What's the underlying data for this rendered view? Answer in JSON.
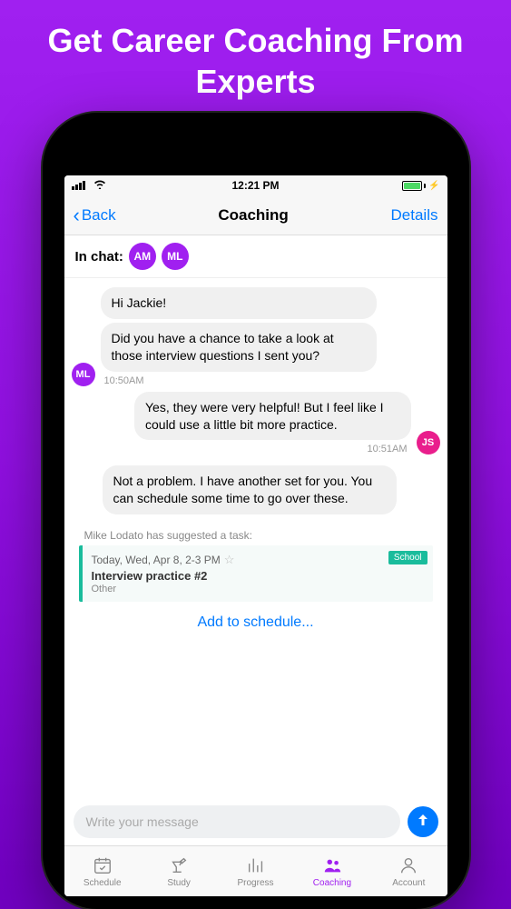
{
  "headline": "Get Career Coaching From Experts",
  "status": {
    "time": "12:21 PM"
  },
  "nav": {
    "back": "Back",
    "title": "Coaching",
    "details": "Details"
  },
  "inChat": {
    "label": "In chat:",
    "participants": [
      {
        "initials": "AM"
      },
      {
        "initials": "ML"
      }
    ]
  },
  "messages": {
    "ml_avatar": "ML",
    "js_avatar": "JS",
    "m1": "Hi Jackie!",
    "m2": "Did you have a chance to take a look at those interview questions I sent you?",
    "t1": "10:50AM",
    "m3": "Yes, they were very helpful! But I feel like I could use a little bit more practice.",
    "t2": "10:51AM",
    "m4": "Not a problem. I have another set for you. You can schedule some time to go over these."
  },
  "task": {
    "suggested_by": "Mike Lodato has suggested a task:",
    "time": "Today, Wed, Apr 8, 2-3 PM",
    "title": "Interview practice #2",
    "category": "Other",
    "badge": "School"
  },
  "actions": {
    "add_to_schedule": "Add to schedule...",
    "input_placeholder": "Write your message"
  },
  "tabs": {
    "schedule": "Schedule",
    "study": "Study",
    "progress": "Progress",
    "coaching": "Coaching",
    "account": "Account"
  }
}
